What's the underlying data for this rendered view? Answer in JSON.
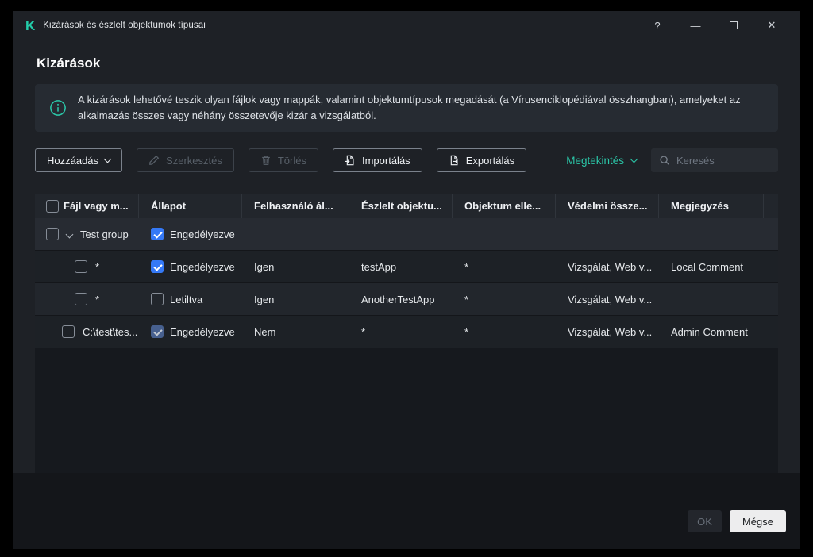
{
  "window": {
    "title": "Kizárások és észlelt objektumok típusai",
    "help": "?",
    "minimize": "—",
    "close": "✕"
  },
  "icons": {
    "logo": "K"
  },
  "page": {
    "title": "Kizárások"
  },
  "banner": {
    "text": "A kizárások lehetővé teszik olyan fájlok vagy mappák, valamint objektumtípusok megadását (a Vírusenciklopédiával összhangban), amelyeket az alkalmazás összes vagy néhány összetevője kizár a vizsgálatból."
  },
  "toolbar": {
    "add": "Hozzáadás",
    "edit": "Szerkesztés",
    "delete": "Törlés",
    "import": "Importálás",
    "export": "Exportálás",
    "view": "Megtekintés",
    "search_placeholder": "Keresés"
  },
  "table": {
    "columns": [
      "Fájl vagy m...",
      "Állapot",
      "Felhasználó ál...",
      "Észlelt objektu...",
      "Objektum elle...",
      "Védelmi össze...",
      "Megjegyzés"
    ],
    "group": {
      "name": "Test group",
      "status": "Engedélyezve"
    },
    "rows": [
      {
        "file": "*",
        "status": "Engedélyezve",
        "user": "Igen",
        "object": "testApp",
        "check": "*",
        "protection": "Vizsgálat, Web v...",
        "comment": "Local Comment"
      },
      {
        "file": "*",
        "status": "Letiltva",
        "user": "Igen",
        "object": "AnotherTestApp",
        "check": "*",
        "protection": "Vizsgálat, Web v...",
        "comment": ""
      },
      {
        "file": "C:\\test\\tes...",
        "status": "Engedélyezve",
        "user": "Nem",
        "object": "*",
        "check": "*",
        "protection": "Vizsgálat, Web v...",
        "comment": "Admin Comment"
      }
    ]
  },
  "footer": {
    "ok": "OK",
    "cancel": "Mégse"
  },
  "colors": {
    "accent": "#2bc8a9",
    "checkbox": "#3579f6"
  }
}
